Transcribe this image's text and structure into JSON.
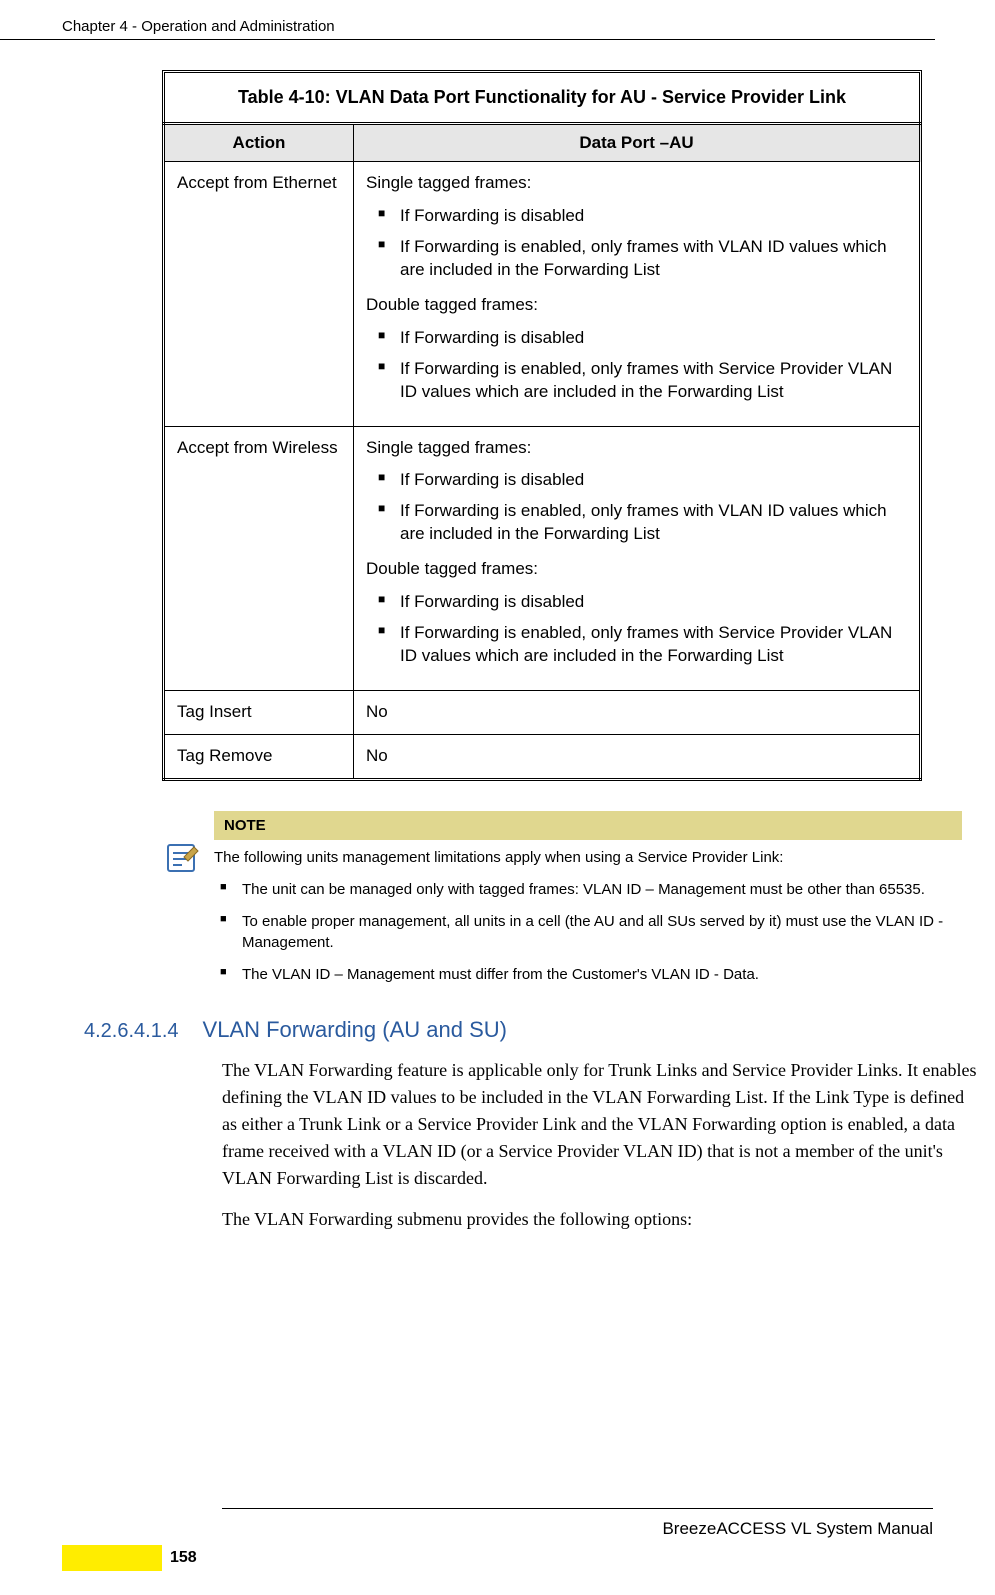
{
  "header": {
    "chapter": "Chapter 4 - Operation and Administration"
  },
  "table": {
    "title": "Table 4-10: VLAN Data Port Functionality for AU - Service Provider Link",
    "headers": {
      "action": "Action",
      "dataport": "Data Port –AU"
    },
    "rows": {
      "r1": {
        "action": "Accept from Ethernet",
        "single_label": "Single tagged frames:",
        "single_b1": "If Forwarding is disabled",
        "single_b2": "If Forwarding is enabled, only frames with VLAN ID values which are included in the Forwarding List",
        "double_label": "Double tagged frames:",
        "double_b1": "If Forwarding is disabled",
        "double_b2": "If Forwarding is enabled, only frames with Service Provider VLAN ID values which are included in the Forwarding List"
      },
      "r2": {
        "action": "Accept from Wireless",
        "single_label": "Single tagged frames:",
        "single_b1": "If Forwarding is disabled",
        "single_b2": "If Forwarding is enabled, only frames with VLAN ID values which are included in the Forwarding List",
        "double_label": "Double tagged frames:",
        "double_b1": "If Forwarding is disabled",
        "double_b2": "If Forwarding is enabled, only frames with Service Provider VLAN ID values which are included in the Forwarding List"
      },
      "r3": {
        "action": "Tag Insert",
        "value": "No"
      },
      "r4": {
        "action": "Tag Remove",
        "value": "No"
      }
    }
  },
  "note": {
    "label": "NOTE",
    "intro": "The following units management limitations apply when using a Service Provider Link:",
    "b1": "The unit can be managed only with tagged frames: VLAN ID – Management must be other than 65535.",
    "b2": "To enable proper management, all units in a cell (the AU and all SUs served by it) must use the VLAN ID - Management.",
    "b3": "The VLAN ID – Management must differ from the Customer's VLAN ID - Data."
  },
  "section": {
    "number": "4.2.6.4.1.4",
    "title": "VLAN Forwarding (AU and SU)",
    "p1": "The VLAN Forwarding feature is applicable only for Trunk Links and Service Provider Links. It enables defining the VLAN ID values to be included in the VLAN Forwarding List. If the Link Type is defined as either a Trunk Link or a Service Provider Link and the VLAN Forwarding option is enabled, a data frame received with a VLAN ID (or a Service Provider VLAN ID) that is not a member of the unit's VLAN Forwarding List is discarded.",
    "p2": "The VLAN Forwarding submenu provides the following options:"
  },
  "footer": {
    "manual": "BreezeACCESS VL System Manual",
    "page": "158"
  }
}
